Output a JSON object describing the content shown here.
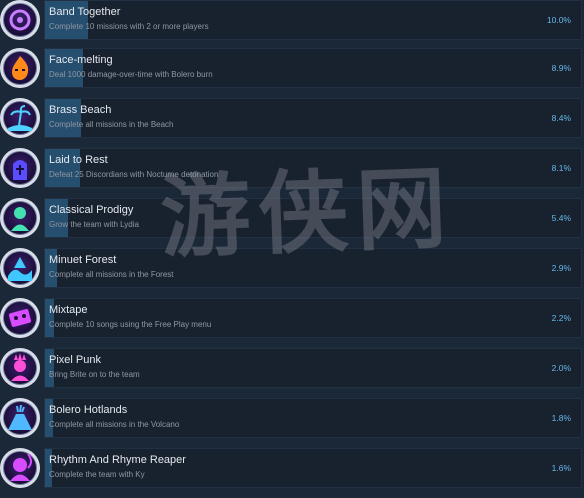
{
  "achievements": [
    {
      "title": "Band Together",
      "description": "Complete 10 missions with 2 or more players",
      "percent": "10.0%",
      "unlock_rate": 10.0,
      "icon": "band-icon",
      "icon_color": "#c77dff"
    },
    {
      "title": "Face-melting",
      "description": "Deal 1000 damage-over-time with Bolero burn",
      "percent": "8.9%",
      "unlock_rate": 8.9,
      "icon": "flame-face-icon",
      "icon_color": "#ff8a1a"
    },
    {
      "title": "Brass Beach",
      "description": "Complete all missions in the Beach",
      "percent": "8.4%",
      "unlock_rate": 8.4,
      "icon": "palm-island-icon",
      "icon_color": "#4fd1ff"
    },
    {
      "title": "Laid to Rest",
      "description": "Defeat 25 Discordians with Nocturne detonation",
      "percent": "8.1%",
      "unlock_rate": 8.1,
      "icon": "tombstone-icon",
      "icon_color": "#5a4cff"
    },
    {
      "title": "Classical Prodigy",
      "description": "Grow the team with Lydia",
      "percent": "5.4%",
      "unlock_rate": 5.4,
      "icon": "character-icon",
      "icon_color": "#44e0b0"
    },
    {
      "title": "Minuet Forest",
      "description": "Complete all missions in the Forest",
      "percent": "2.9%",
      "unlock_rate": 2.9,
      "icon": "forest-wave-icon",
      "icon_color": "#3fc8ff"
    },
    {
      "title": "Mixtape",
      "description": "Complete 10 songs using the Free Play menu",
      "percent": "2.2%",
      "unlock_rate": 2.2,
      "icon": "cassette-icon",
      "icon_color": "#d84cff"
    },
    {
      "title": "Pixel Punk",
      "description": "Bring Brite on to the team",
      "percent": "2.0%",
      "unlock_rate": 2.0,
      "icon": "punk-character-icon",
      "icon_color": "#ff4fd8"
    },
    {
      "title": "Bolero Hotlands",
      "description": "Complete all missions in the Volcano",
      "percent": "1.8%",
      "unlock_rate": 1.8,
      "icon": "volcano-icon",
      "icon_color": "#4fb8ff"
    },
    {
      "title": "Rhythm And Rhyme Reaper",
      "description": "Complete the team with Ky",
      "percent": "1.6%",
      "unlock_rate": 1.6,
      "icon": "reaper-icon",
      "icon_color": "#d64cff"
    }
  ],
  "watermark": "游侠网"
}
